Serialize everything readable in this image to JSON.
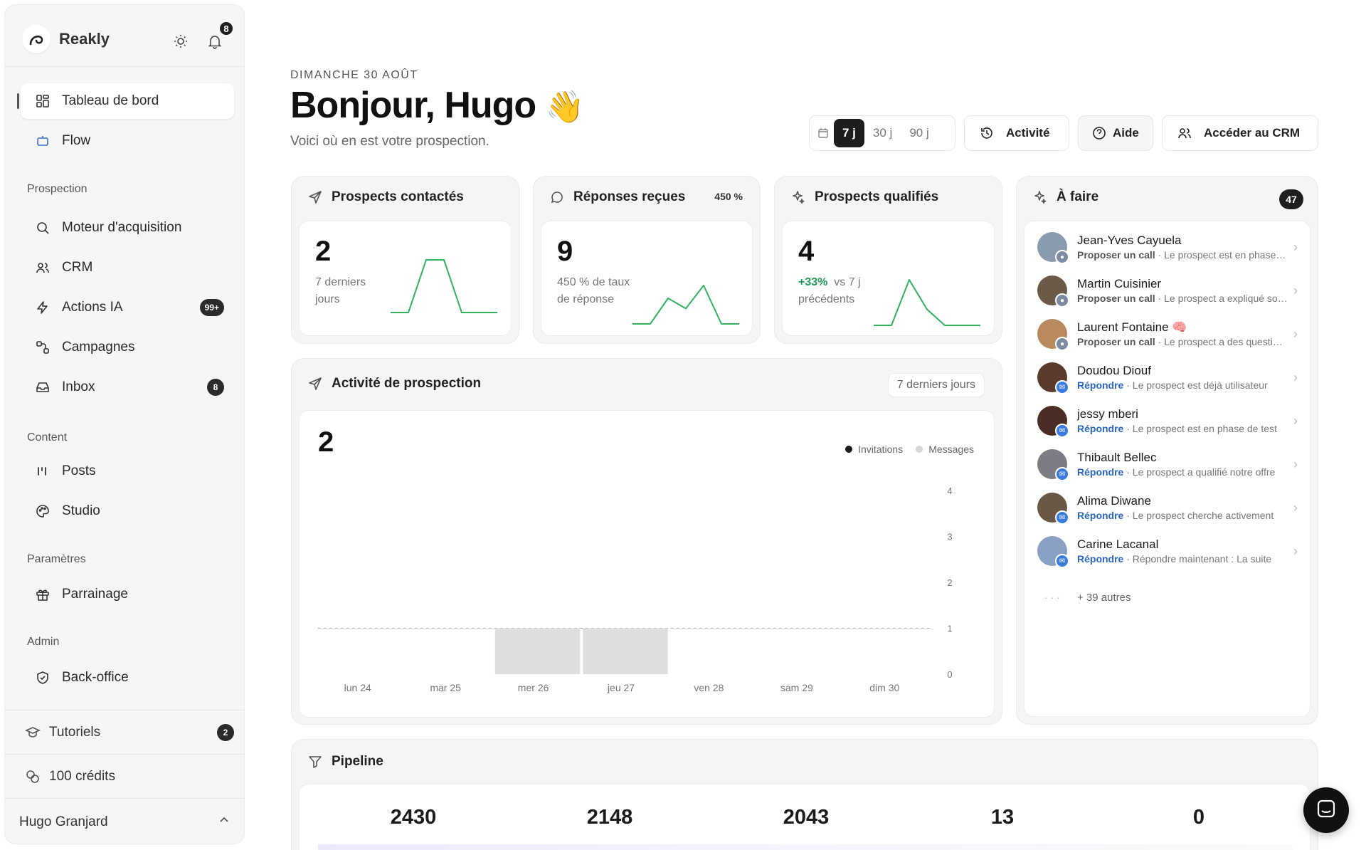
{
  "app": {
    "name": "Reakly",
    "notification_count": "8"
  },
  "sidebar": {
    "main": [
      {
        "label": "Tableau de bord"
      },
      {
        "label": "Flow"
      }
    ],
    "sections": {
      "prospection": "Prospection",
      "content": "Content",
      "parametres": "Paramètres",
      "admin": "Admin"
    },
    "prospection_items": [
      {
        "label": "Moteur d'acquisition"
      },
      {
        "label": "CRM"
      },
      {
        "label": "Actions IA",
        "count": "99+"
      },
      {
        "label": "Campagnes"
      },
      {
        "label": "Inbox",
        "count": "8"
      }
    ],
    "content_items": [
      {
        "label": "Posts"
      },
      {
        "label": "Studio"
      }
    ],
    "parametres_items": [
      {
        "label": "Parrainage"
      }
    ],
    "admin_items": [
      {
        "label": "Back-office"
      }
    ],
    "tutoriels": {
      "label": "Tutoriels",
      "count": "2"
    },
    "credits": {
      "label": "100 crédits"
    },
    "user": {
      "name": "Hugo Granjard"
    }
  },
  "header": {
    "date": "DIMANCHE 30 AOÛT",
    "greeting": "Bonjour, Hugo",
    "emoji": "👋",
    "subtitle": "Voici où en est votre prospection.",
    "ranges": [
      "7 j",
      "30 j",
      "90 j"
    ],
    "active_range": "7 j",
    "activity_label": "Activité",
    "help_label": "Aide",
    "crm_label": "Accéder au CRM"
  },
  "metrics": [
    {
      "title": "Prospects contactés",
      "value": "2",
      "sub": "7 derniers jours",
      "spark": [
        0,
        0,
        1,
        1,
        0,
        0,
        0
      ]
    },
    {
      "title": "Réponses reçues",
      "pill": "450 %",
      "value": "9",
      "sub": "450 % de taux de réponse",
      "spark": [
        0,
        0,
        1,
        0.6,
        1.5,
        0,
        0
      ]
    },
    {
      "title": "Prospects qualifiés",
      "value": "4",
      "sub_pos": "+33%",
      "sub": "vs 7 j précédents",
      "spark": [
        0,
        0,
        1,
        0.35,
        0,
        0,
        0
      ]
    }
  ],
  "activity": {
    "title": "Activité de prospection",
    "range": "7 derniers jours",
    "total": "2",
    "legend": [
      {
        "label": "Invitations",
        "color": "#1a1a1a"
      },
      {
        "label": "Messages",
        "color": "#d8d8d8"
      }
    ]
  },
  "chart_data": {
    "type": "bar",
    "categories": [
      "lun 24",
      "mar 25",
      "mer 26",
      "jeu 27",
      "ven 28",
      "sam 29",
      "dim 30"
    ],
    "series": [
      {
        "name": "Invitations",
        "values": [
          0,
          0,
          0,
          0,
          0,
          0,
          0
        ]
      },
      {
        "name": "Messages",
        "values": [
          0,
          0,
          1,
          1,
          0,
          0,
          0
        ]
      }
    ],
    "yticks": [
      "0",
      "1",
      "2",
      "3",
      "4"
    ],
    "ylim": [
      0,
      4
    ],
    "reference_line": 1
  },
  "todo": {
    "title": "À faire",
    "count": "47",
    "items": [
      {
        "name": "Jean-Yves Cayuela",
        "action": "Proposer un call",
        "kind": "call",
        "detail": " · Le prospect est en phase de réflexion"
      },
      {
        "name": "Martin Cuisinier",
        "action": "Proposer un call",
        "kind": "call",
        "detail": " · Le prospect a expliqué son besoin"
      },
      {
        "name": "Laurent Fontaine 🧠",
        "action": "Proposer un call",
        "kind": "call",
        "detail": " · Le prospect a des questions"
      },
      {
        "name": "Doudou Diouf",
        "action": "Répondre",
        "kind": "reply",
        "detail": " · Le prospect est déjà utilisateur"
      },
      {
        "name": "jessy mberi",
        "action": "Répondre",
        "kind": "reply",
        "detail": " · Le prospect est en phase de test"
      },
      {
        "name": "Thibault Bellec",
        "action": "Répondre",
        "kind": "reply",
        "detail": " · Le prospect a qualifié notre offre"
      },
      {
        "name": "Alima Diwane",
        "action": "Répondre",
        "kind": "reply",
        "detail": " · Le prospect cherche activement"
      },
      {
        "name": "Carine Lacanal",
        "action": "Répondre",
        "kind": "reply",
        "detail": " · Répondre maintenant : La suite"
      }
    ],
    "more": "+ 39 autres",
    "more_dots": "· · ·"
  },
  "pipeline": {
    "title": "Pipeline",
    "values": [
      "2430",
      "2148",
      "2043",
      "13",
      "0"
    ]
  }
}
